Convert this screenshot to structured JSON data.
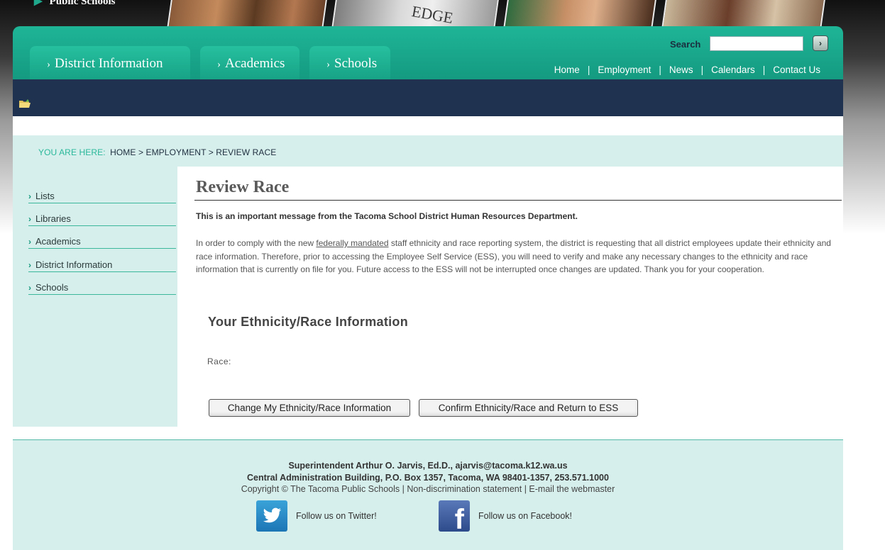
{
  "banner": {
    "logo_text": "Public Schools",
    "photo_word": "EDGE"
  },
  "nav": {
    "tabs": [
      {
        "label": "District Information"
      },
      {
        "label": "Academics"
      },
      {
        "label": "Schools"
      }
    ],
    "tab_chevron": "›",
    "search_label": "Search",
    "search_value": "",
    "search_button_glyph": "›",
    "top_links": [
      "Home",
      "Employment",
      "News",
      "Calendars",
      "Contact Us"
    ],
    "separator": "|"
  },
  "breadcrumb": {
    "prefix": "YOU ARE HERE:",
    "path": "HOME > EMPLOYMENT > REVIEW RACE"
  },
  "sidebar": {
    "chevron": "›",
    "items": [
      {
        "label": "Lists"
      },
      {
        "label": "Libraries"
      },
      {
        "label": "Academics"
      },
      {
        "label": "District Information"
      },
      {
        "label": "Schools"
      }
    ]
  },
  "main": {
    "title": "Review Race",
    "intro_bold": "This is an important message from the Tacoma School District Human Resources Department.",
    "intro_before_link": "In order to comply with the new ",
    "intro_link": "federally mandated",
    "intro_after_link": " staff ethnicity and race reporting system, the district is requesting that all district employees update their ethnicity and race information. Therefore, prior to accessing the Employee Self Service (ESS), you will need to verify and make any necessary changes to the ethnicity and race information that is currently on file for you. Future access to the ESS will not be interrupted once changes are updated. Thank you for your cooperation.",
    "section_heading": "Your Ethnicity/Race Information",
    "race_label": "Race:",
    "buttons": {
      "change": "Change My Ethnicity/Race Information",
      "confirm": "Confirm Ethnicity/Race and Return to ESS"
    }
  },
  "footer": {
    "superintendent": "Superintendent Arthur O. Jarvis, Ed.D., ",
    "email": "ajarvis@tacoma.k12.wa.us",
    "address": "Central Administration Building, P.O. Box 1357, Tacoma, WA 98401-1357, 253.571.1000",
    "copyright": "Copyright © The Tacoma Public Schools",
    "nondiscrimination": "Non-discrimination statement",
    "webmaster": "E-mail the webmaster",
    "separator": " | ",
    "twitter_label": "Follow us on Twitter!",
    "facebook_label": "Follow us on Facebook!",
    "facebook_glyph": "f"
  },
  "colors": {
    "brand_green": "#1fb597",
    "dark_navy": "#1f3350",
    "pale_teal": "#d6efec"
  },
  "icons": {
    "folder": "folder-icon",
    "twitter": "twitter-bird-icon",
    "facebook": "facebook-f-icon",
    "search_go": "arrow-right-icon"
  }
}
